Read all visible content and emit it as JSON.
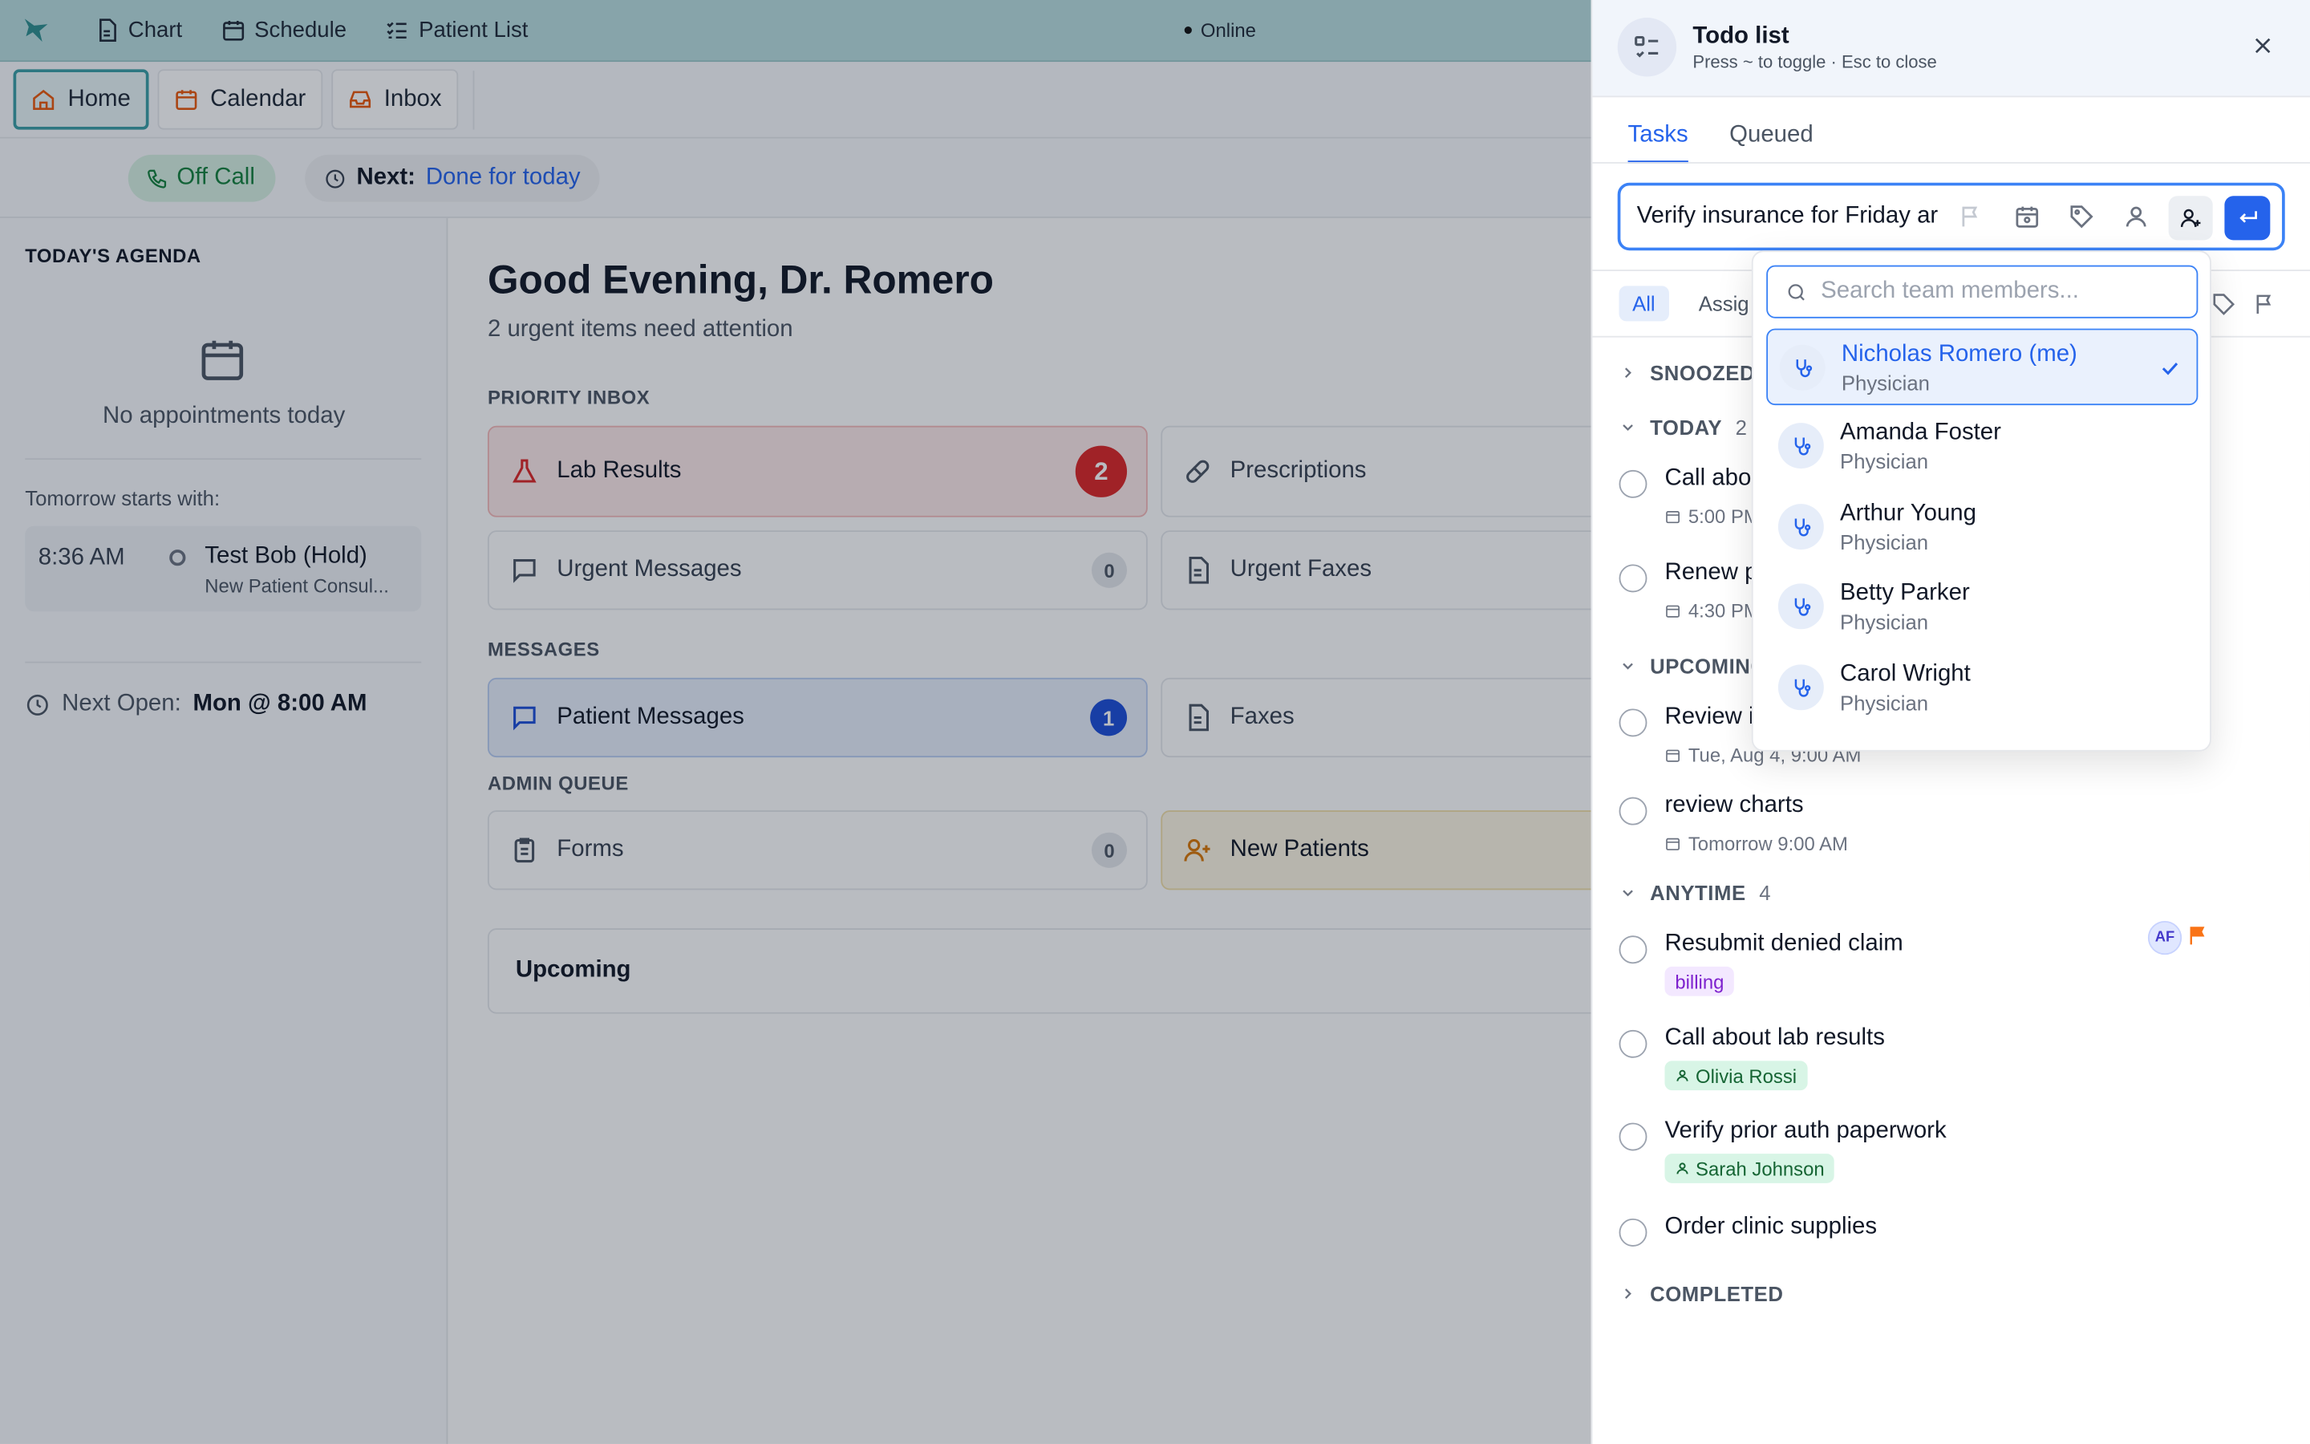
{
  "topnav": {
    "items": [
      {
        "label": "Chart",
        "icon": "document-icon"
      },
      {
        "label": "Schedule",
        "icon": "calendar-icon"
      },
      {
        "label": "Patient List",
        "icon": "list-icon"
      }
    ],
    "status": "Online"
  },
  "tabs": [
    {
      "label": "Home",
      "icon": "home-icon",
      "active": true
    },
    {
      "label": "Calendar",
      "icon": "calendar-icon",
      "active": false
    },
    {
      "label": "Inbox",
      "icon": "inbox-icon",
      "active": false
    }
  ],
  "status_row": {
    "call_status": "Off Call",
    "next_label": "Next:",
    "next_value": "Done for today"
  },
  "sidebar": {
    "title": "TODAY'S AGENDA",
    "empty_text": "No appointments today",
    "tomorrow_label": "Tomorrow starts with:",
    "appointment": {
      "time": "8:36 AM",
      "name": "Test Bob (Hold)",
      "type": "New Patient Consul..."
    },
    "next_open_label": "Next Open:",
    "next_open_value": "Mon @ 8:00 AM"
  },
  "main": {
    "greeting": "Good Evening, Dr. Romero",
    "subtitle": "2 urgent items need attention",
    "sections": {
      "priority": "PRIORITY INBOX",
      "messages": "MESSAGES",
      "admin": "ADMIN QUEUE"
    },
    "cards": {
      "lab_results": {
        "label": "Lab Results",
        "count": "2"
      },
      "prescriptions": {
        "label": "Prescriptions"
      },
      "urgent_messages": {
        "label": "Urgent Messages",
        "count": "0"
      },
      "urgent_faxes": {
        "label": "Urgent Faxes"
      },
      "patient_messages": {
        "label": "Patient Messages",
        "count": "1"
      },
      "faxes": {
        "label": "Faxes"
      },
      "forms": {
        "label": "Forms",
        "count": "0"
      },
      "new_patients": {
        "label": "New Patients"
      }
    },
    "upcoming": "Upcoming"
  },
  "todo": {
    "title": "Todo list",
    "hint": "Press ~ to toggle · Esc to close",
    "tabs": {
      "tasks": "Tasks",
      "queued": "Queued"
    },
    "input_value": "Verify insurance for Friday ar",
    "filters": {
      "all": "All",
      "assigned": "Assig"
    },
    "groups": {
      "snoozed": "SNOOZED",
      "today": "TODAY",
      "today_count": "2",
      "upcoming": "UPCOMING",
      "anytime": "ANYTIME",
      "anytime_count": "4",
      "completed": "COMPLETED"
    },
    "tasks": {
      "t1": {
        "title": "Call abo",
        "meta": "5:00 PM"
      },
      "t2": {
        "title": "Renew p",
        "meta": "4:30 PM"
      },
      "t3": {
        "title": "Review i",
        "meta": "Tue, Aug 4, 9:00 AM"
      },
      "t4": {
        "title": "review charts",
        "meta": "Tomorrow 9:00 AM"
      },
      "t5": {
        "title": "Resubmit denied claim",
        "tag": "billing",
        "assignee_initials": "AF"
      },
      "t6": {
        "title": "Call about lab results",
        "assignee": "Olivia Rossi"
      },
      "t7": {
        "title": "Verify prior auth paperwork",
        "assignee": "Sarah Johnson"
      },
      "t8": {
        "title": "Order clinic supplies"
      }
    }
  },
  "assignee_dropdown": {
    "search_placeholder": "Search team members...",
    "members": [
      {
        "name": "Nicholas Romero (me)",
        "role": "Physician",
        "selected": true
      },
      {
        "name": "Amanda Foster",
        "role": "Physician",
        "selected": false
      },
      {
        "name": "Arthur Young",
        "role": "Physician",
        "selected": false
      },
      {
        "name": "Betty Parker",
        "role": "Physician",
        "selected": false
      },
      {
        "name": "Carol Wright",
        "role": "Physician",
        "selected": false
      }
    ]
  },
  "colors": {
    "accent_teal": "#3a9ea5",
    "primary_blue": "#2563eb",
    "danger_red": "#dc2626",
    "success_green": "#15803d",
    "flag_orange": "#f97316"
  }
}
